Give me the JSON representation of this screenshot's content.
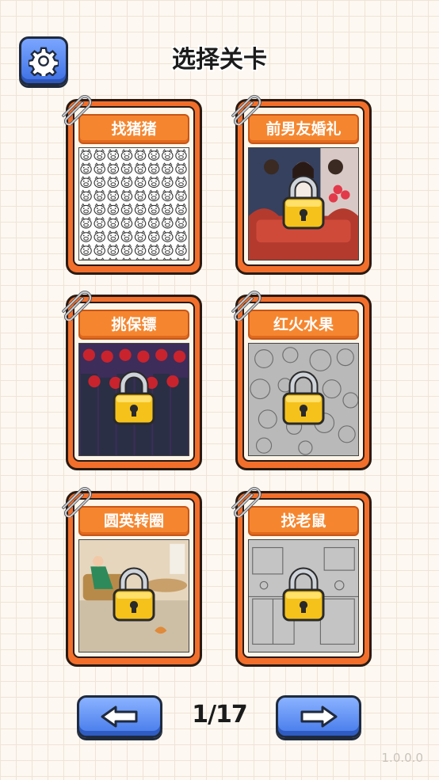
{
  "header": {
    "title": "选择关卡",
    "settings_icon": "gear-icon"
  },
  "levels": [
    {
      "name": "找猪猪",
      "locked": false,
      "theme": "pig-doodle"
    },
    {
      "name": "前男友婚礼",
      "locked": true,
      "theme": "wedding"
    },
    {
      "name": "挑保镖",
      "locked": true,
      "theme": "bodyguards"
    },
    {
      "name": "红火水果",
      "locked": true,
      "theme": "fruit-sketch"
    },
    {
      "name": "圆英转圈",
      "locked": true,
      "theme": "living-room"
    },
    {
      "name": "找老鼠",
      "locked": true,
      "theme": "kitchen-sketch"
    }
  ],
  "pagination": {
    "indicator": "1/17",
    "prev_icon": "arrow-left-icon",
    "next_icon": "arrow-right-icon"
  },
  "footer": {
    "version": "1.0.0.0"
  },
  "colors": {
    "card_orange": "#f26f2b",
    "button_blue": "#4479ea",
    "lock_gold": "#f5c21b"
  }
}
